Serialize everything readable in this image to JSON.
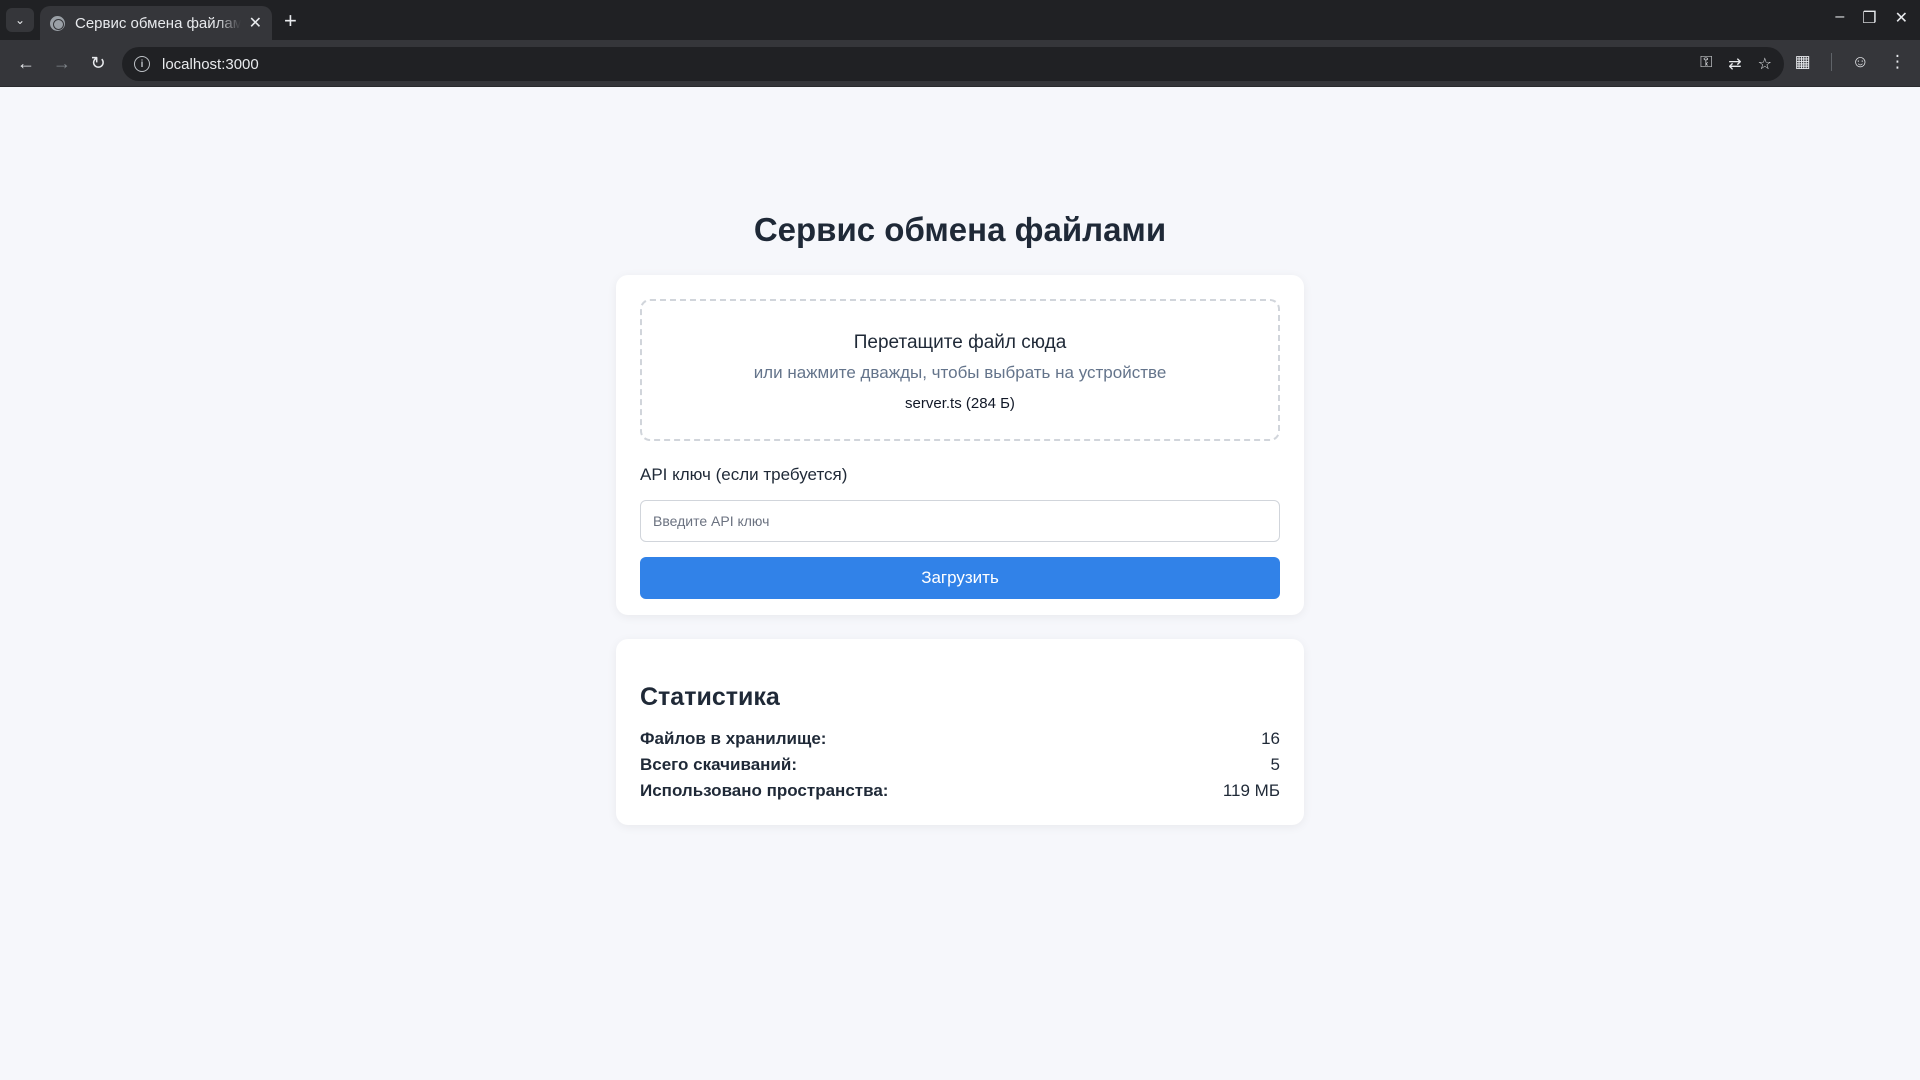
{
  "browser": {
    "tab_title": "Сервис обмена файлами",
    "url": "localhost:3000"
  },
  "page": {
    "title": "Сервис обмена файлами"
  },
  "upload": {
    "drop_title": "Перетащите файл сюда",
    "drop_subtitle": "или нажмите дважды, чтобы выбрать на устройстве",
    "selected_file": "server.ts (284 Б)",
    "api_label": "API ключ (если требуется)",
    "api_placeholder": "Введите API ключ",
    "api_value": "",
    "button_label": "Загрузить",
    "accent_color": "#3182e8"
  },
  "stats": {
    "title": "Статистика",
    "rows": [
      {
        "label": "Файлов в хранилище:",
        "value": "16"
      },
      {
        "label": "Всего скачиваний:",
        "value": "5"
      },
      {
        "label": "Использовано пространства:",
        "value": "119 МБ"
      }
    ]
  },
  "icons": {
    "tab_favicon": "globe-icon",
    "back": "arrow-left-icon",
    "forward": "arrow-right-icon",
    "reload": "reload-icon",
    "site_info": "info-icon",
    "password": "key-icon",
    "translate": "translate-icon",
    "bookmark": "star-icon",
    "extensions": "puzzle-icon",
    "profile": "profile-icon",
    "menu": "kebab-menu-icon"
  }
}
